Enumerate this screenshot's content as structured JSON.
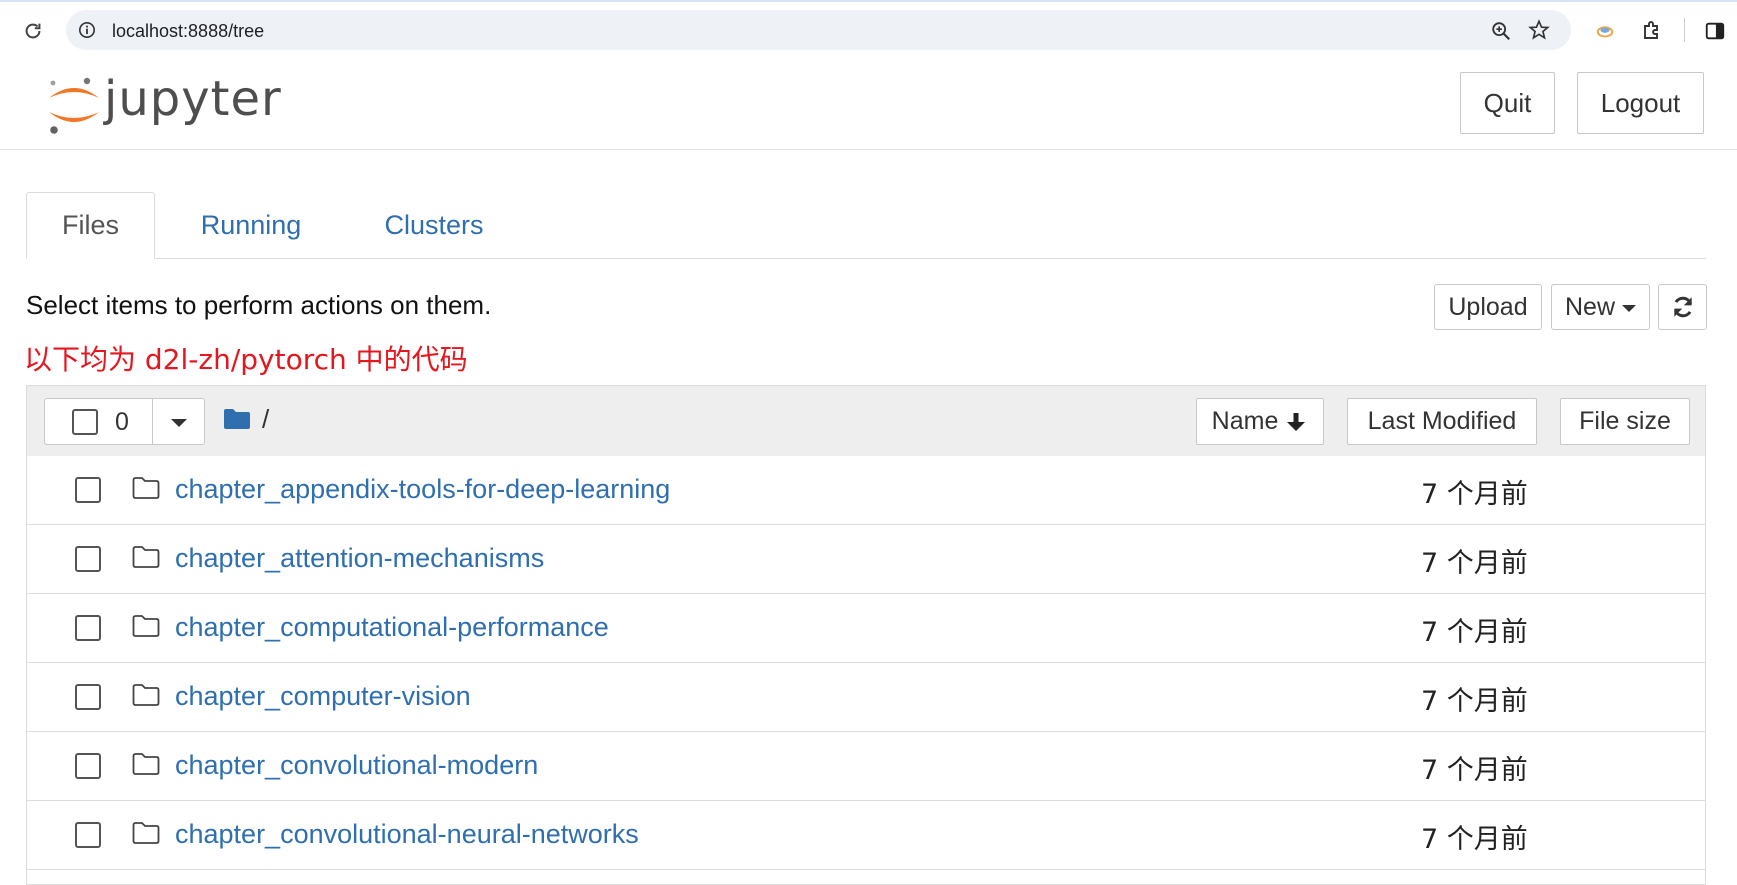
{
  "browser": {
    "url": "localhost:8888/tree"
  },
  "header": {
    "logo_text": "jupyter",
    "quit_label": "Quit",
    "logout_label": "Logout"
  },
  "tabs": [
    {
      "label": "Files"
    },
    {
      "label": "Running"
    },
    {
      "label": "Clusters"
    }
  ],
  "toolbar": {
    "hint": "Select items to perform actions on them.",
    "note": "以下均为 d2l-zh/pytorch 中的代码",
    "upload_label": "Upload",
    "new_label": "New"
  },
  "list": {
    "selected_count": "0",
    "path": "/",
    "columns": {
      "name": "Name",
      "last_modified": "Last Modified",
      "file_size": "File size"
    },
    "rows": [
      {
        "name": "chapter_appendix-tools-for-deep-learning",
        "modified": "7 个月前"
      },
      {
        "name": "chapter_attention-mechanisms",
        "modified": "7 个月前"
      },
      {
        "name": "chapter_computational-performance",
        "modified": "7 个月前"
      },
      {
        "name": "chapter_computer-vision",
        "modified": "7 个月前"
      },
      {
        "name": "chapter_convolutional-modern",
        "modified": "7 个月前"
      },
      {
        "name": "chapter_convolutional-neural-networks",
        "modified": "7 个月前"
      }
    ]
  },
  "colors": {
    "link": "#2f6fb0",
    "note": "#e4171f",
    "logo_orange": "#f37726"
  }
}
